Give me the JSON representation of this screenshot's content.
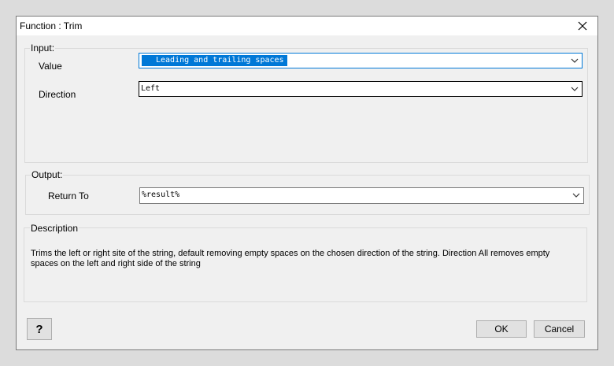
{
  "window": {
    "title": "Function : Trim",
    "close_icon": "close-icon"
  },
  "input_group": {
    "label": "Input:",
    "value_label": "Value",
    "value_text": "Leading and trailing spaces",
    "direction_label": "Direction",
    "direction_value": "Left"
  },
  "output_group": {
    "label": "Output:",
    "return_label": "Return To",
    "return_value": "%result%"
  },
  "description_group": {
    "label": "Description",
    "text": "Trims the left or right site of the string, default removing empty spaces on the chosen direction of the string. Direction All removes empty spaces on the left and right side of the string"
  },
  "buttons": {
    "help": "?",
    "ok": "OK",
    "cancel": "Cancel"
  },
  "colors": {
    "accent": "#0078d7",
    "dialog_bg": "#f0f0f0"
  }
}
